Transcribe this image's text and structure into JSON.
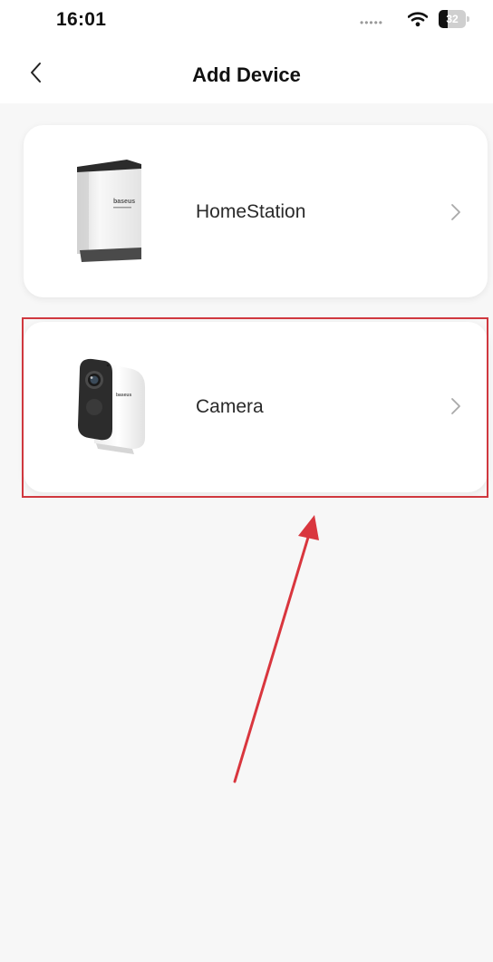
{
  "status_bar": {
    "time": "16:01",
    "signal_icon": "signal-dots-icon",
    "wifi_icon": "wifi-icon",
    "battery_icon": "battery-icon",
    "battery_level": "32"
  },
  "nav": {
    "back_icon": "chevron-left-icon",
    "title": "Add Device"
  },
  "devices": [
    {
      "label": "HomeStation",
      "image_icon": "homestation-device-image",
      "chevron_icon": "chevron-right-icon"
    },
    {
      "label": "Camera",
      "image_icon": "camera-device-image",
      "chevron_icon": "chevron-right-icon"
    }
  ],
  "annotation": {
    "highlight_color": "#d0383f",
    "arrow_color": "#d9363e",
    "target": "Camera"
  },
  "colors": {
    "page_background": "#f7f7f7",
    "card_background": "#ffffff"
  }
}
